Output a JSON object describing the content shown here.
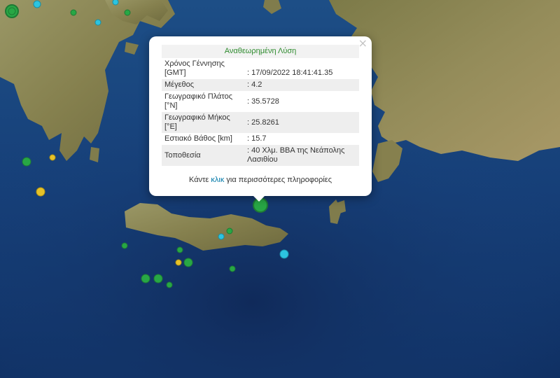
{
  "popup": {
    "title": "Αναθεωρημένη Λύση",
    "close_label": "×",
    "rows": [
      {
        "label": "Χρόνος Γέννησης [GMT]",
        "value": ": 17/09/2022 18:41:41.35"
      },
      {
        "label": "Μέγεθος",
        "value": ": 4.2"
      },
      {
        "label": "Γεωγραφικό Πλάτος [°N]",
        "value": ": 35.5728"
      },
      {
        "label": "Γεωγραφικό Μήκος [°E]",
        "value": ": 25.8261"
      },
      {
        "label": "Εστιακό Βάθος [km]",
        "value": ": 15.7"
      },
      {
        "label": "Τοποθεσία",
        "value": ": 40 Χλμ. ΒΒΑ της Νεάπολης Λασιθίου"
      }
    ],
    "more_prefix": "Κάντε",
    "more_link": "κλικ",
    "more_suffix": "για περισσότερες πληροφορίες"
  },
  "colors": {
    "sea_deep": "#0d2b5c",
    "sea": "#1b4a8a",
    "land": "#8a8a5a",
    "marker_green": "#28a745",
    "marker_yellow": "#e6c229",
    "marker_cyan": "#2cc4e0",
    "link": "#0078a8"
  },
  "markers": [
    {
      "name": "green"
    },
    {
      "name": "green"
    },
    {
      "name": "yellow"
    },
    {
      "name": "cyan"
    },
    {
      "name": "green"
    },
    {
      "name": "cyan"
    },
    {
      "name": "green"
    },
    {
      "name": "yellow"
    }
  ]
}
